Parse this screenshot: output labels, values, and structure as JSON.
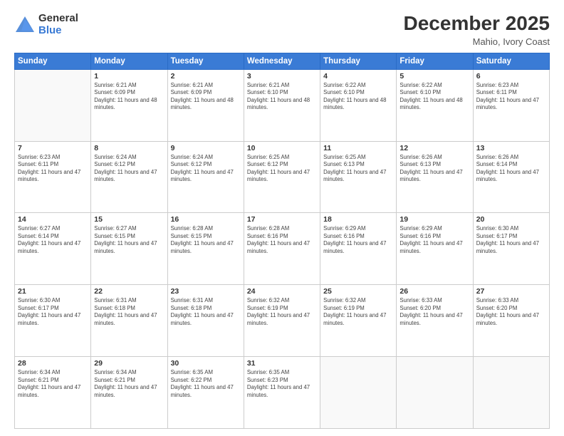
{
  "header": {
    "logo_general": "General",
    "logo_blue": "Blue",
    "main_title": "December 2025",
    "subtitle": "Mahio, Ivory Coast"
  },
  "calendar": {
    "days_of_week": [
      "Sunday",
      "Monday",
      "Tuesday",
      "Wednesday",
      "Thursday",
      "Friday",
      "Saturday"
    ],
    "weeks": [
      [
        {
          "day": "",
          "sunrise": "",
          "sunset": "",
          "daylight": ""
        },
        {
          "day": "1",
          "sunrise": "Sunrise: 6:21 AM",
          "sunset": "Sunset: 6:09 PM",
          "daylight": "Daylight: 11 hours and 48 minutes."
        },
        {
          "day": "2",
          "sunrise": "Sunrise: 6:21 AM",
          "sunset": "Sunset: 6:09 PM",
          "daylight": "Daylight: 11 hours and 48 minutes."
        },
        {
          "day": "3",
          "sunrise": "Sunrise: 6:21 AM",
          "sunset": "Sunset: 6:10 PM",
          "daylight": "Daylight: 11 hours and 48 minutes."
        },
        {
          "day": "4",
          "sunrise": "Sunrise: 6:22 AM",
          "sunset": "Sunset: 6:10 PM",
          "daylight": "Daylight: 11 hours and 48 minutes."
        },
        {
          "day": "5",
          "sunrise": "Sunrise: 6:22 AM",
          "sunset": "Sunset: 6:10 PM",
          "daylight": "Daylight: 11 hours and 48 minutes."
        },
        {
          "day": "6",
          "sunrise": "Sunrise: 6:23 AM",
          "sunset": "Sunset: 6:11 PM",
          "daylight": "Daylight: 11 hours and 47 minutes."
        }
      ],
      [
        {
          "day": "7",
          "sunrise": "Sunrise: 6:23 AM",
          "sunset": "Sunset: 6:11 PM",
          "daylight": "Daylight: 11 hours and 47 minutes."
        },
        {
          "day": "8",
          "sunrise": "Sunrise: 6:24 AM",
          "sunset": "Sunset: 6:12 PM",
          "daylight": "Daylight: 11 hours and 47 minutes."
        },
        {
          "day": "9",
          "sunrise": "Sunrise: 6:24 AM",
          "sunset": "Sunset: 6:12 PM",
          "daylight": "Daylight: 11 hours and 47 minutes."
        },
        {
          "day": "10",
          "sunrise": "Sunrise: 6:25 AM",
          "sunset": "Sunset: 6:12 PM",
          "daylight": "Daylight: 11 hours and 47 minutes."
        },
        {
          "day": "11",
          "sunrise": "Sunrise: 6:25 AM",
          "sunset": "Sunset: 6:13 PM",
          "daylight": "Daylight: 11 hours and 47 minutes."
        },
        {
          "day": "12",
          "sunrise": "Sunrise: 6:26 AM",
          "sunset": "Sunset: 6:13 PM",
          "daylight": "Daylight: 11 hours and 47 minutes."
        },
        {
          "day": "13",
          "sunrise": "Sunrise: 6:26 AM",
          "sunset": "Sunset: 6:14 PM",
          "daylight": "Daylight: 11 hours and 47 minutes."
        }
      ],
      [
        {
          "day": "14",
          "sunrise": "Sunrise: 6:27 AM",
          "sunset": "Sunset: 6:14 PM",
          "daylight": "Daylight: 11 hours and 47 minutes."
        },
        {
          "day": "15",
          "sunrise": "Sunrise: 6:27 AM",
          "sunset": "Sunset: 6:15 PM",
          "daylight": "Daylight: 11 hours and 47 minutes."
        },
        {
          "day": "16",
          "sunrise": "Sunrise: 6:28 AM",
          "sunset": "Sunset: 6:15 PM",
          "daylight": "Daylight: 11 hours and 47 minutes."
        },
        {
          "day": "17",
          "sunrise": "Sunrise: 6:28 AM",
          "sunset": "Sunset: 6:16 PM",
          "daylight": "Daylight: 11 hours and 47 minutes."
        },
        {
          "day": "18",
          "sunrise": "Sunrise: 6:29 AM",
          "sunset": "Sunset: 6:16 PM",
          "daylight": "Daylight: 11 hours and 47 minutes."
        },
        {
          "day": "19",
          "sunrise": "Sunrise: 6:29 AM",
          "sunset": "Sunset: 6:16 PM",
          "daylight": "Daylight: 11 hours and 47 minutes."
        },
        {
          "day": "20",
          "sunrise": "Sunrise: 6:30 AM",
          "sunset": "Sunset: 6:17 PM",
          "daylight": "Daylight: 11 hours and 47 minutes."
        }
      ],
      [
        {
          "day": "21",
          "sunrise": "Sunrise: 6:30 AM",
          "sunset": "Sunset: 6:17 PM",
          "daylight": "Daylight: 11 hours and 47 minutes."
        },
        {
          "day": "22",
          "sunrise": "Sunrise: 6:31 AM",
          "sunset": "Sunset: 6:18 PM",
          "daylight": "Daylight: 11 hours and 47 minutes."
        },
        {
          "day": "23",
          "sunrise": "Sunrise: 6:31 AM",
          "sunset": "Sunset: 6:18 PM",
          "daylight": "Daylight: 11 hours and 47 minutes."
        },
        {
          "day": "24",
          "sunrise": "Sunrise: 6:32 AM",
          "sunset": "Sunset: 6:19 PM",
          "daylight": "Daylight: 11 hours and 47 minutes."
        },
        {
          "day": "25",
          "sunrise": "Sunrise: 6:32 AM",
          "sunset": "Sunset: 6:19 PM",
          "daylight": "Daylight: 11 hours and 47 minutes."
        },
        {
          "day": "26",
          "sunrise": "Sunrise: 6:33 AM",
          "sunset": "Sunset: 6:20 PM",
          "daylight": "Daylight: 11 hours and 47 minutes."
        },
        {
          "day": "27",
          "sunrise": "Sunrise: 6:33 AM",
          "sunset": "Sunset: 6:20 PM",
          "daylight": "Daylight: 11 hours and 47 minutes."
        }
      ],
      [
        {
          "day": "28",
          "sunrise": "Sunrise: 6:34 AM",
          "sunset": "Sunset: 6:21 PM",
          "daylight": "Daylight: 11 hours and 47 minutes."
        },
        {
          "day": "29",
          "sunrise": "Sunrise: 6:34 AM",
          "sunset": "Sunset: 6:21 PM",
          "daylight": "Daylight: 11 hours and 47 minutes."
        },
        {
          "day": "30",
          "sunrise": "Sunrise: 6:35 AM",
          "sunset": "Sunset: 6:22 PM",
          "daylight": "Daylight: 11 hours and 47 minutes."
        },
        {
          "day": "31",
          "sunrise": "Sunrise: 6:35 AM",
          "sunset": "Sunset: 6:23 PM",
          "daylight": "Daylight: 11 hours and 47 minutes."
        },
        {
          "day": "",
          "sunrise": "",
          "sunset": "",
          "daylight": ""
        },
        {
          "day": "",
          "sunrise": "",
          "sunset": "",
          "daylight": ""
        },
        {
          "day": "",
          "sunrise": "",
          "sunset": "",
          "daylight": ""
        }
      ]
    ]
  }
}
